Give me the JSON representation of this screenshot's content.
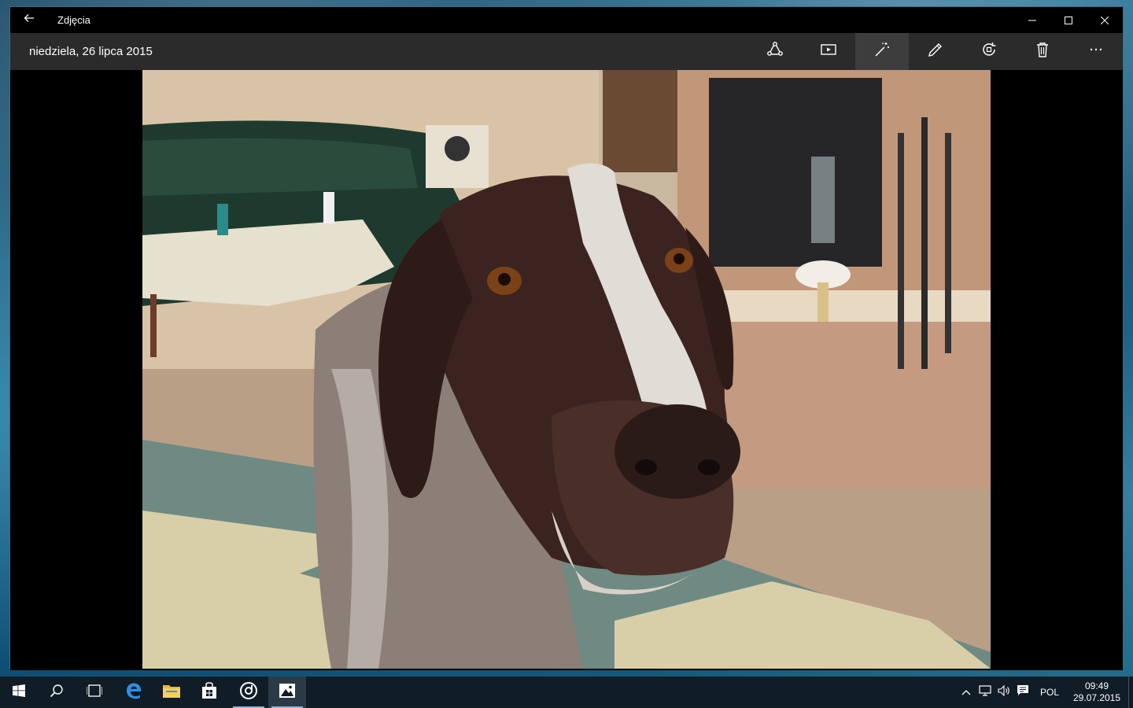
{
  "window": {
    "title": "Zdjęcia",
    "back_icon": "arrow-left-icon",
    "controls": [
      "minimize-icon",
      "maximize-icon",
      "close-icon"
    ]
  },
  "toolbar": {
    "date": "niedziela, 26 lipca 2015",
    "buttons": [
      {
        "name": "share",
        "icon": "share-icon",
        "active": false
      },
      {
        "name": "slideshow",
        "icon": "slideshow-icon",
        "active": false
      },
      {
        "name": "enhance",
        "icon": "magic-wand-icon",
        "active": true
      },
      {
        "name": "edit",
        "icon": "pencil-icon",
        "active": false
      },
      {
        "name": "rotate",
        "icon": "rotate-icon",
        "active": false
      },
      {
        "name": "delete",
        "icon": "trash-icon",
        "active": false
      },
      {
        "name": "more",
        "icon": "more-icon",
        "active": false
      }
    ]
  },
  "taskbar": {
    "apps": [
      {
        "name": "start",
        "icon": "windows-icon"
      },
      {
        "name": "search",
        "icon": "search-icon"
      },
      {
        "name": "task-view",
        "icon": "task-view-icon"
      },
      {
        "name": "edge",
        "icon": "edge-icon"
      },
      {
        "name": "file-explorer",
        "icon": "folder-icon"
      },
      {
        "name": "store",
        "icon": "store-icon"
      },
      {
        "name": "groove",
        "icon": "groove-music-icon"
      },
      {
        "name": "photos",
        "icon": "photos-icon"
      }
    ],
    "tray": {
      "language": "POL",
      "time": "09:49",
      "date": "29.07.2015"
    }
  },
  "colors": {
    "accent": "#8fb8d8",
    "toolbar_bg": "#2b2b2b",
    "taskbar_bg": "#101c26"
  }
}
